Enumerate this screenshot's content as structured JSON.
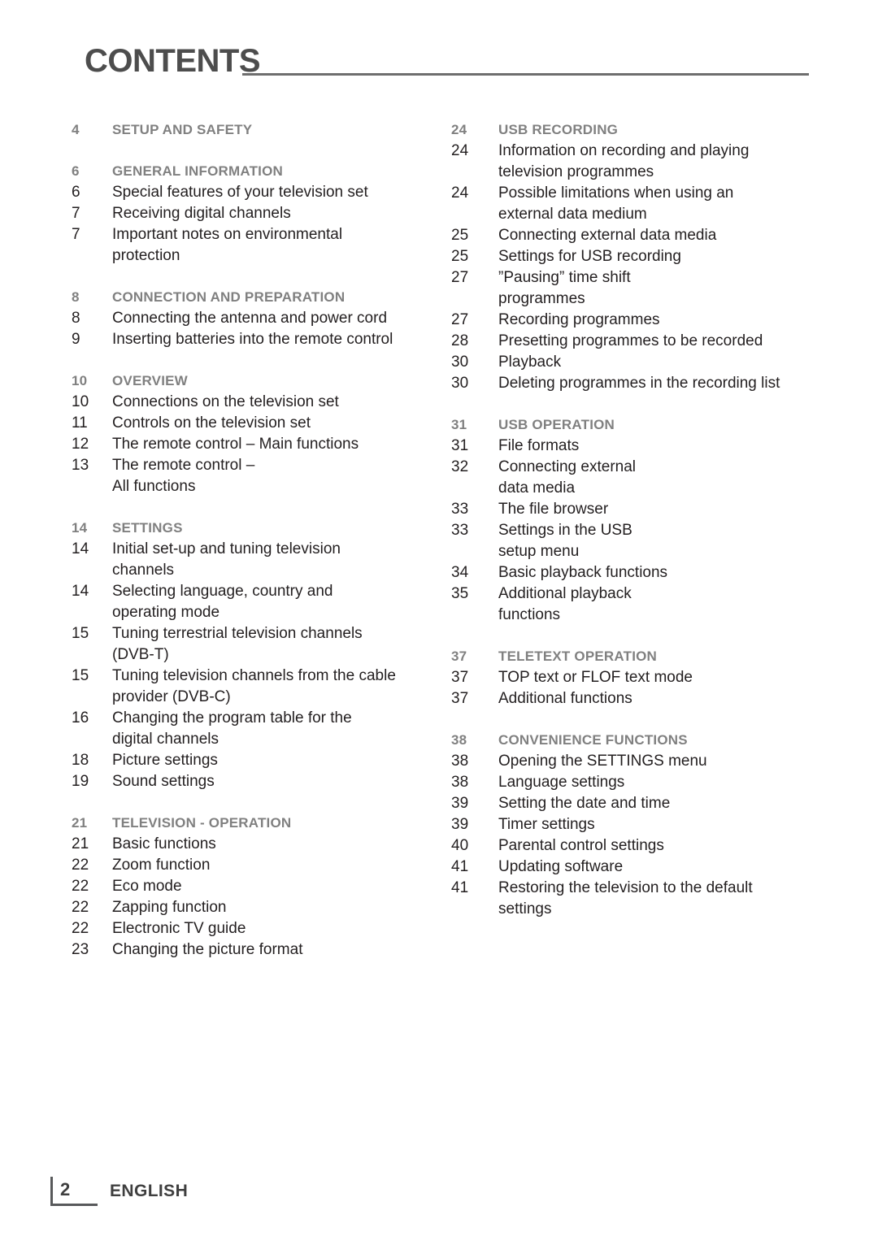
{
  "header": {
    "title": "CONTENTS"
  },
  "footer": {
    "page_number": "2",
    "language": "ENGLISH"
  },
  "columns": {
    "left": [
      {
        "heading": {
          "page": "4",
          "label": "SETUP AND SAFETY"
        },
        "entries": []
      },
      {
        "heading": {
          "page": "6",
          "label": "GENERAL INFORMATION"
        },
        "entries": [
          {
            "page": "6",
            "label": "Special features of your television set"
          },
          {
            "page": "7",
            "label": "Receiving digital channels"
          },
          {
            "page": "7",
            "label": "Important notes on environmental",
            "cont": "protection"
          }
        ]
      },
      {
        "heading": {
          "page": "8",
          "label": "CONNECTION AND PREPARATION"
        },
        "entries": [
          {
            "page": "8",
            "label": "Connecting the antenna and power cord"
          },
          {
            "page": "9",
            "label": "Inserting batteries into the remote control"
          }
        ]
      },
      {
        "heading": {
          "page": "10",
          "label": "OVERVIEW"
        },
        "entries": [
          {
            "page": "10",
            "label": "Connections on the television set"
          },
          {
            "page": "11",
            "label": "Controls on the television set"
          },
          {
            "page": "12",
            "label": "The remote control – Main functions"
          },
          {
            "page": "13",
            "label": "The remote control –",
            "cont": "All functions"
          }
        ]
      },
      {
        "heading": {
          "page": "14",
          "label": "SETTINGS"
        },
        "entries": [
          {
            "page": "14",
            "label": "Initial set-up and tuning television",
            "cont": "channels"
          },
          {
            "page": "14",
            "label": "Selecting language, country and",
            "cont": "operating mode"
          },
          {
            "page": "15",
            "label": "Tuning terrestrial television channels",
            "cont": "(DVB-T)"
          },
          {
            "page": "15",
            "label": "Tuning television channels from the cable",
            "cont": "provider (DVB-C)"
          },
          {
            "page": "16",
            "label": "Changing the program table for the",
            "cont": "digital channels"
          },
          {
            "page": "18",
            "label": "Picture settings"
          },
          {
            "page": "19",
            "label": "Sound settings"
          }
        ]
      },
      {
        "heading": {
          "page": "21",
          "label": "TELEVISION - OPERATION"
        },
        "entries": [
          {
            "page": "21",
            "label": "Basic functions"
          },
          {
            "page": "22",
            "label": "Zoom function"
          },
          {
            "page": "22",
            "label": "Eco mode"
          },
          {
            "page": "22",
            "label": "Zapping function"
          },
          {
            "page": "22",
            "label": "Electronic TV guide"
          },
          {
            "page": "23",
            "label": "Changing the picture format"
          }
        ]
      }
    ],
    "right": [
      {
        "heading": {
          "page": "24",
          "label": "USB RECORDING"
        },
        "entries": [
          {
            "page": "24",
            "label": "Information on recording and playing",
            "cont": "television programmes"
          },
          {
            "page": "24",
            "label": "Possible limitations when using an",
            "cont": "external data medium"
          },
          {
            "page": "25",
            "label": "Connecting external data media"
          },
          {
            "page": "25",
            "label": "Settings for USB recording"
          },
          {
            "page": "27",
            "label": "”Pausing” time shift",
            "cont": "programmes"
          },
          {
            "page": "27",
            "label": "Recording programmes"
          },
          {
            "page": "28",
            "label": "Presetting programmes to be recorded"
          },
          {
            "page": "30",
            "label": "Playback"
          },
          {
            "page": "30",
            "label": "Deleting programmes in the recording list"
          }
        ]
      },
      {
        "heading": {
          "page": "31",
          "label": "USB OPERATION"
        },
        "entries": [
          {
            "page": "31",
            "label": "File formats"
          },
          {
            "page": "32",
            "label": "Connecting external",
            "cont": "data media"
          },
          {
            "page": "33",
            "label": "The file browser"
          },
          {
            "page": "33",
            "label": "Settings in the USB",
            "cont": "setup menu"
          },
          {
            "page": "34",
            "label": "Basic playback functions"
          },
          {
            "page": "35",
            "label": "Additional playback",
            "cont": "functions"
          }
        ]
      },
      {
        "heading": {
          "page": "37",
          "label": "TELETEXT OPERATION"
        },
        "entries": [
          {
            "page": "37",
            "label": "TOP text or FLOF text mode"
          },
          {
            "page": "37",
            "label": "Additional functions"
          }
        ]
      },
      {
        "heading": {
          "page": "38",
          "label": "CONVENIENCE FUNCTIONS"
        },
        "entries": [
          {
            "page": "38",
            "label": "Opening the SETTINGS menu"
          },
          {
            "page": "38",
            "label": "Language settings"
          },
          {
            "page": "39",
            "label": "Setting the date and time"
          },
          {
            "page": "39",
            "label": "Timer settings"
          },
          {
            "page": "40",
            "label": "Parental control settings"
          },
          {
            "page": "41",
            "label": "Updating software"
          },
          {
            "page": "41",
            "label": "Restoring the television to the default",
            "cont": "settings"
          }
        ]
      }
    ]
  }
}
